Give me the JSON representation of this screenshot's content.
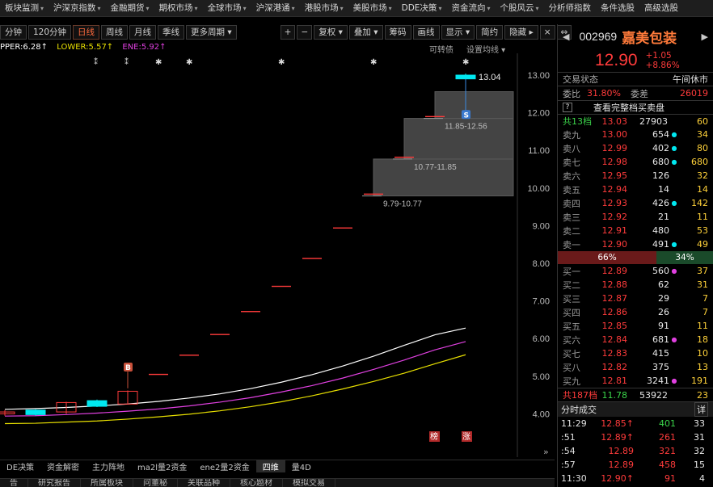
{
  "topmenu": [
    {
      "label": "板块监测",
      "arrow": true
    },
    {
      "label": "沪深京指数",
      "arrow": true
    },
    {
      "label": "金融期货",
      "arrow": true
    },
    {
      "label": "期权市场",
      "arrow": true
    },
    {
      "label": "全球市场",
      "arrow": true
    },
    {
      "label": "沪深港通",
      "arrow": true
    },
    {
      "label": "港股市场",
      "arrow": true
    },
    {
      "label": "美股市场",
      "arrow": true
    },
    {
      "label": "DDE决策",
      "arrow": true
    },
    {
      "label": "资金流向",
      "arrow": true
    },
    {
      "label": "个股风云",
      "arrow": true
    },
    {
      "label": "分析师指数",
      "arrow": false
    },
    {
      "label": "条件选股",
      "arrow": false
    },
    {
      "label": "高级选股",
      "arrow": false
    }
  ],
  "toolbar": {
    "items": [
      "分钟",
      "120分钟",
      "日线",
      "周线",
      "月线",
      "季线",
      "更多周期 ▾",
      "+",
      "−",
      "复权 ▾",
      "叠加 ▾",
      "筹码",
      "画线",
      "显示 ▾",
      "简约",
      "隐藏 ▸"
    ],
    "active": "日线"
  },
  "indicators": {
    "upper": "PPER:6.28↑",
    "lower": "LOWER:5.57↑",
    "ene": "ENE:5.92↑",
    "right1": "可转债",
    "right2": "设置均线 ▾"
  },
  "colors": {
    "upper": "#ffffff",
    "lower": "#e8e000",
    "ene": "#e040e0",
    "up": "#ff3b3b",
    "down": "#00e8f0",
    "accent": "#ff7a3a"
  },
  "chart_data": {
    "type": "candlestick",
    "y_ticks": [
      "13.00",
      "12.00",
      "11.00",
      "10.00",
      "9.00",
      "8.00",
      "7.00",
      "6.00",
      "5.00",
      "4.00"
    ],
    "candles": [
      {
        "o": 4.0,
        "c": 4.05,
        "h": 4.1,
        "l": 3.95
      },
      {
        "o": 4.1,
        "c": 3.98,
        "h": 4.12,
        "l": 3.95
      },
      {
        "o": 4.05,
        "c": 4.3,
        "h": 4.32,
        "l": 4.0
      },
      {
        "o": 4.35,
        "c": 4.2,
        "h": 4.38,
        "l": 4.18
      },
      {
        "o": 4.26,
        "c": 4.6,
        "h": 4.62,
        "l": 4.25
      },
      {
        "o": 5.05,
        "c": 5.05,
        "h": 5.05,
        "l": 5.05
      },
      {
        "o": 5.56,
        "c": 5.56,
        "h": 5.56,
        "l": 5.56
      },
      {
        "o": 6.11,
        "c": 6.11,
        "h": 6.11,
        "l": 6.11
      },
      {
        "o": 6.72,
        "c": 6.72,
        "h": 6.72,
        "l": 6.72
      },
      {
        "o": 7.39,
        "c": 7.39,
        "h": 7.39,
        "l": 7.39
      },
      {
        "o": 8.13,
        "c": 8.13,
        "h": 8.13,
        "l": 8.13
      },
      {
        "o": 8.94,
        "c": 8.94,
        "h": 8.94,
        "l": 8.94
      },
      {
        "o": 9.84,
        "c": 9.84,
        "h": 9.84,
        "l": 9.84
      },
      {
        "o": 10.82,
        "c": 10.82,
        "h": 10.82,
        "l": 10.82
      },
      {
        "o": 11.9,
        "c": 11.9,
        "h": 11.9,
        "l": 11.9
      },
      {
        "o": 13.0,
        "c": 12.9,
        "h": 13.04,
        "l": 12.52
      }
    ],
    "upper_band": [
      4.12,
      4.14,
      4.17,
      4.21,
      4.26,
      4.33,
      4.42,
      4.53,
      4.67,
      4.84,
      5.04,
      5.27,
      5.53,
      5.82,
      6.1,
      6.28
    ],
    "ene_band": [
      3.94,
      3.95,
      3.98,
      4.02,
      4.07,
      4.13,
      4.21,
      4.31,
      4.43,
      4.58,
      4.75,
      4.95,
      5.18,
      5.43,
      5.7,
      5.92
    ],
    "lower_band": [
      3.74,
      3.75,
      3.78,
      3.81,
      3.86,
      3.92,
      3.99,
      4.08,
      4.19,
      4.32,
      4.48,
      4.66,
      4.86,
      5.08,
      5.33,
      5.57
    ],
    "volume_profile": [
      {
        "range": "9.79-10.77",
        "low": 9.79,
        "high": 10.77
      },
      {
        "range": "10.77-11.85",
        "low": 10.77,
        "high": 11.85
      },
      {
        "range": "11.85-12.56",
        "low": 11.85,
        "high": 12.56
      }
    ],
    "high_label": "13.04",
    "markers": {
      "buy": "B",
      "sell": "S"
    },
    "bottom_tags": [
      "榜",
      "涨"
    ]
  },
  "bottom_tabs": [
    "DE决策",
    "资金解密",
    "主力阵地",
    "ma2l量2资金",
    "ene2量2资金",
    "四维",
    "量4D"
  ],
  "bottom_tabs_active": "四维",
  "bottom_tabs2": [
    "告",
    "研究报告",
    "所属板块",
    "问董秘",
    "关联品种",
    "核心题材",
    "模拟交易"
  ],
  "quote": {
    "code": "002969",
    "name": "嘉美包装",
    "price": "12.90",
    "change": "+1.05",
    "change_pct": "+8.86%",
    "status_label": "交易状态",
    "status_value": "午间休市",
    "webi_label": "委比",
    "webi_value": "31.80%",
    "weicha_label": "委差",
    "weicha_value": "26019",
    "full_book_label": "查看完整档买卖盘",
    "sell_total_label": "共13档",
    "sell_total_price": "13.03",
    "sell_total_vol": "27903",
    "sell_total_n": "60",
    "sells": [
      {
        "label": "卖九",
        "price": "13.00",
        "vol": "654",
        "dot": "cyan",
        "chg": "34"
      },
      {
        "label": "卖八",
        "price": "12.99",
        "vol": "402",
        "dot": "cyan",
        "chg": "80"
      },
      {
        "label": "卖七",
        "price": "12.98",
        "vol": "680",
        "dot": "cyan",
        "chg": "680"
      },
      {
        "label": "卖六",
        "price": "12.95",
        "vol": "126",
        "dot": "",
        "chg": "32"
      },
      {
        "label": "卖五",
        "price": "12.94",
        "vol": "14",
        "dot": "",
        "chg": "14"
      },
      {
        "label": "卖四",
        "price": "12.93",
        "vol": "426",
        "dot": "cyan",
        "chg": "142"
      },
      {
        "label": "卖三",
        "price": "12.92",
        "vol": "21",
        "dot": "",
        "chg": "11"
      },
      {
        "label": "卖二",
        "price": "12.91",
        "vol": "480",
        "dot": "",
        "chg": "53"
      },
      {
        "label": "卖一",
        "price": "12.90",
        "vol": "491",
        "dot": "cyan",
        "chg": "49"
      }
    ],
    "buy_pct": "66%",
    "sell_pct": "34%",
    "buys": [
      {
        "label": "买一",
        "price": "12.89",
        "vol": "560",
        "dot": "magenta",
        "chg": "37"
      },
      {
        "label": "买二",
        "price": "12.88",
        "vol": "62",
        "dot": "",
        "chg": "31"
      },
      {
        "label": "买三",
        "price": "12.87",
        "vol": "29",
        "dot": "",
        "chg": "7"
      },
      {
        "label": "买四",
        "price": "12.86",
        "vol": "26",
        "dot": "",
        "chg": "7"
      },
      {
        "label": "买五",
        "price": "12.85",
        "vol": "91",
        "dot": "",
        "chg": "11"
      },
      {
        "label": "买六",
        "price": "12.84",
        "vol": "681",
        "dot": "magenta",
        "chg": "18"
      },
      {
        "label": "买七",
        "price": "12.83",
        "vol": "415",
        "dot": "",
        "chg": "10"
      },
      {
        "label": "买八",
        "price": "12.82",
        "vol": "375",
        "dot": "",
        "chg": "13"
      },
      {
        "label": "买九",
        "price": "12.81",
        "vol": "3241",
        "dot": "magenta",
        "chg": "191"
      }
    ],
    "buy_total_label": "共187档",
    "buy_total_price": "11.78",
    "buy_total_vol": "53922",
    "buy_total_n": "23",
    "ticks_title": "分时成交",
    "ticks_detail": "详",
    "ticks": [
      {
        "time": "11:29",
        "price": "12.85↑",
        "vol": "401",
        "n": "33",
        "green": true
      },
      {
        "time": ":51",
        "price": "12.89↑",
        "vol": "261",
        "n": "31",
        "green": false
      },
      {
        "time": ":54",
        "price": "12.89",
        "vol": "321",
        "n": "32",
        "green": false
      },
      {
        "time": ":57",
        "price": "12.89",
        "vol": "458",
        "n": "15",
        "green": false
      },
      {
        "time": "11:30",
        "price": "12.90↑",
        "vol": "91",
        "n": "4",
        "green": false
      }
    ]
  }
}
